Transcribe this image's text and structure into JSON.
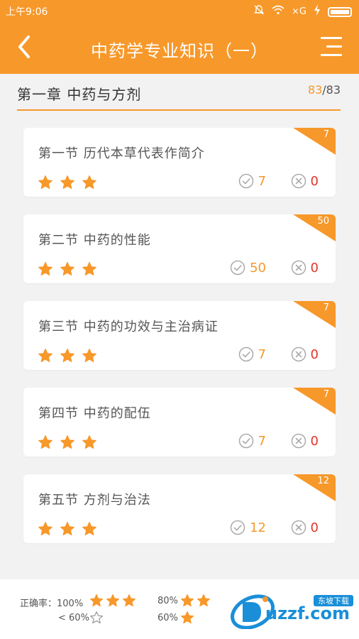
{
  "status": {
    "time": "上午9:06",
    "extra": "×G"
  },
  "header": {
    "title": "中药学专业知识（一）"
  },
  "chapter": {
    "title": "第一章  中药与方剂",
    "done": "83",
    "total": "/83"
  },
  "sections": [
    {
      "title": "第一节  历代本草代表作简介",
      "badge": "7",
      "right": "7",
      "wrong": "0",
      "stars": 3
    },
    {
      "title": "第二节  中药的性能",
      "badge": "50",
      "right": "50",
      "wrong": "0",
      "stars": 3
    },
    {
      "title": "第三节  中药的功效与主治病证",
      "badge": "7",
      "right": "7",
      "wrong": "0",
      "stars": 3
    },
    {
      "title": "第四节  中药的配伍",
      "badge": "7",
      "right": "7",
      "wrong": "0",
      "stars": 3
    },
    {
      "title": "第五节  方剂与治法",
      "badge": "12",
      "right": "12",
      "wrong": "0",
      "stars": 3
    }
  ],
  "legend": {
    "label": "正确率：100%",
    "l80": "80%",
    "l60below": "< 60%",
    "l60": "60%"
  },
  "logo": {
    "text": "uzzf.com",
    "tag": "东坡下载"
  },
  "colors": {
    "accent": "#f7982a",
    "wrong": "#e5332a",
    "background": "#f2f2f2"
  },
  "icons": {
    "back": "chevron-left-icon",
    "menu": "menu-icon",
    "star": "star-icon",
    "right": "check-circle-icon",
    "wrong": "x-circle-icon"
  }
}
